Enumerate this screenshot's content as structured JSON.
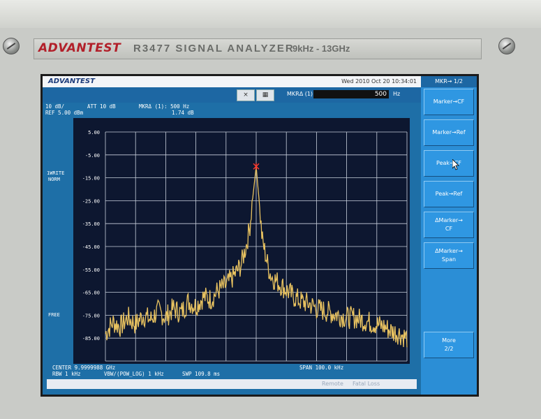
{
  "instrument": {
    "brand": "ADVANTEST",
    "model": "R3477  SIGNAL  ANALYZER",
    "freq_range": "9kHz - 13GHz"
  },
  "screen": {
    "logo": "ADVANTEST",
    "datetime": "Wed 2010 Oct 20 10:34:01",
    "toolbar": {
      "close_glyph": "×",
      "grid_glyph": "▦",
      "marker_label": "MKRΔ (1)",
      "marker_value": "500",
      "marker_unit": "Hz"
    },
    "info": {
      "scale": "10 dB/",
      "ref": "REF 5.00 dBm",
      "att": "ATT 10 dB",
      "mkr": "MKRΔ (1): 500 Hz",
      "mkr_level": "1.74 dB"
    },
    "side_labels": {
      "trace_mode": "1WRITE",
      "detector": "NORM",
      "run": "FREE"
    },
    "bottom": {
      "center": "CENTER 9.9999988 GHz",
      "rbw": "RBW 1 kHz",
      "vbw": "VBW/(POW_LOG) 1 kHz",
      "swp": "SWP 109.8 ms",
      "span": "SPAN 100.0 kHz"
    },
    "status_bar": {
      "item1": "Remote",
      "item2": "Fatal Loss"
    },
    "softkeys": {
      "title": "MKR→ 1/2",
      "keys": [
        {
          "line1": "Marker→CF",
          "line2": ""
        },
        {
          "line1": "Marker→Ref",
          "line2": ""
        },
        {
          "line1": "Peak→CF",
          "line2": ""
        },
        {
          "line1": "Peak→Ref",
          "line2": ""
        },
        {
          "line1": "ΔMarker→",
          "line2": "CF"
        },
        {
          "line1": "ΔMarker→",
          "line2": "Span"
        },
        {
          "line1": "More",
          "line2": "2/2"
        }
      ]
    }
  },
  "chart_data": {
    "type": "line",
    "y_tick_labels": [
      "5.00",
      "-5.00",
      "-15.00",
      "-25.00",
      "-35.00",
      "-45.00",
      "-55.00",
      "-65.00",
      "-75.00",
      "-85.00"
    ],
    "ylim": [
      -95,
      5
    ],
    "xlim": [
      -50,
      50
    ],
    "x_unit": "kHz offset from center",
    "grid": true,
    "trace_color": "#e8c260",
    "marker_color": "#ff3b2f",
    "peak": {
      "x": 0,
      "y": -10
    },
    "series": [
      {
        "x": [
          -50,
          -47.5,
          -45,
          -42.5,
          -40,
          -37.5,
          -35,
          -32.5,
          -30,
          -27.5,
          -25,
          -22.5,
          -20,
          -17.5,
          -15,
          -12.5,
          -10,
          -7.5,
          -5,
          -4,
          -3,
          -2,
          -1.5,
          -1,
          -0.5,
          0,
          0.5,
          1,
          1.5,
          2,
          3,
          4,
          5,
          7.5,
          10,
          12.5,
          15,
          17.5,
          20,
          22.5,
          25,
          27.5,
          30,
          32.5,
          35,
          37.5,
          40,
          42.5,
          45,
          47.5,
          50
        ],
        "values": [
          -83,
          -78,
          -80,
          -76,
          -79,
          -75,
          -77,
          -73,
          -76,
          -72,
          -74,
          -69,
          -71,
          -67,
          -68,
          -64,
          -62,
          -58,
          -53,
          -48,
          -43,
          -35,
          -28,
          -22,
          -16,
          -10,
          -18,
          -25,
          -34,
          -42,
          -48,
          -54,
          -58,
          -61,
          -64,
          -67,
          -69,
          -70,
          -72,
          -73,
          -74,
          -75,
          -76,
          -76,
          -77,
          -78,
          -79,
          -80,
          -82,
          -83,
          -85
        ]
      }
    ]
  }
}
